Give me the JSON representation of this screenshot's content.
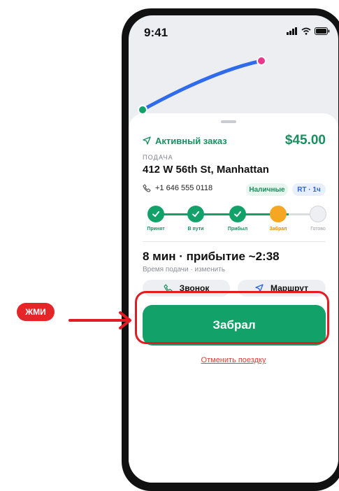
{
  "status_bar": {
    "time": "9:41"
  },
  "order": {
    "status_label": "Активный заказ",
    "price": "$45.00",
    "pickup_label": "ПОДАЧА",
    "address": "412 W 56th St, Manhattan",
    "phone": "+1 646 555 0118",
    "payment_badge": "Наличные",
    "rt_badge": "RT · 1ч"
  },
  "progress": {
    "steps": [
      {
        "label": "Принят",
        "state": "done"
      },
      {
        "label": "В пути",
        "state": "done"
      },
      {
        "label": "Прибыл",
        "state": "done"
      },
      {
        "label": "Забрал",
        "state": "current"
      },
      {
        "label": "Готово",
        "state": "pending"
      }
    ]
  },
  "eta": {
    "headline": "8 мин · прибытие ~2:38",
    "sub": "Время подачи · изменить"
  },
  "actions": {
    "call_label": "Звонок",
    "route_label": "Маршрут",
    "primary_label": "Забрал",
    "cancel_label": "Отменить поездку"
  },
  "annotation": {
    "tag_label": "ЖМИ"
  },
  "colors": {
    "accent": "#13a16a",
    "current_step": "#f5a623",
    "route": "#2f6bea",
    "highlight": "#e11d23"
  }
}
